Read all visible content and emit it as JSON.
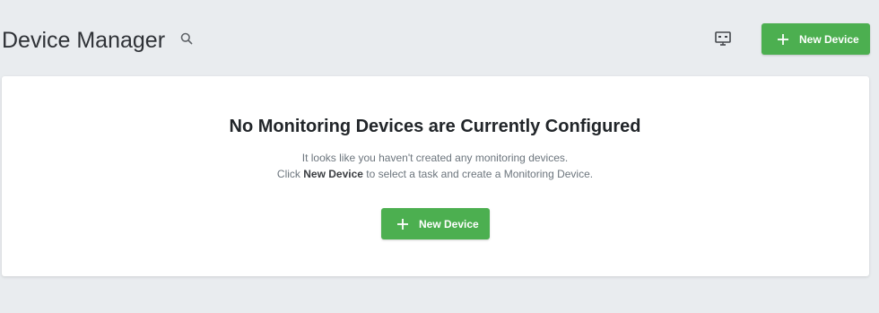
{
  "header": {
    "title": "Device Manager",
    "search_icon": "search-icon",
    "monitor_icon": "monitor-icon",
    "new_device_label": "New Device"
  },
  "empty_state": {
    "heading": "No Monitoring Devices are Currently Configured",
    "line1": "It looks like you haven't created any monitoring devices.",
    "line2_prefix": "Click ",
    "line2_bold": "New Device",
    "line2_suffix": " to select a task and create a Monitoring Device.",
    "new_device_label": "New Device"
  },
  "colors": {
    "background": "#e9ecef",
    "card": "#ffffff",
    "accent_green": "#4caf50",
    "title_text": "#2f3237",
    "muted_text": "#6c757d"
  }
}
